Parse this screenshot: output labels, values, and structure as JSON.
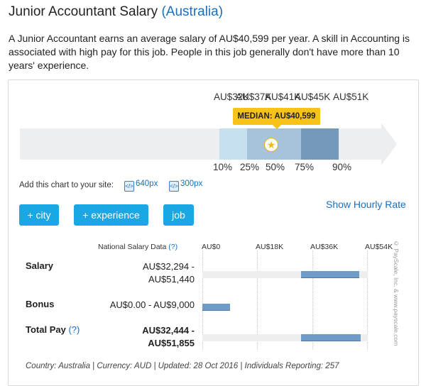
{
  "header": {
    "title": "Junior Accountant Salary",
    "location": "(Australia)"
  },
  "description": "A Junior Accountant earns an average salary of AU$40,599 per year. A skill in Accounting is associated with high pay for this job. People in this job generally don't have more than 10 years' experience.",
  "chart_data": {
    "type": "bar",
    "title": "",
    "percentiles": [
      "10%",
      "25%",
      "50%",
      "75%",
      "90%"
    ],
    "values_label": [
      "AU$32K",
      "AU$37K",
      "AU$41K",
      "AU$45K",
      "AU$51K"
    ],
    "values": [
      32000,
      37000,
      41000,
      45000,
      51000
    ],
    "median_label": "MEDIAN: AU$40,599",
    "median": 40599
  },
  "embed": {
    "label": "Add this chart to your site:",
    "opt1": "640px",
    "opt2": "300px"
  },
  "buttons": {
    "city": "+ city",
    "experience": "+ experience",
    "job": "job"
  },
  "hourly_link": "Show Hourly Rate",
  "table": {
    "header": "National Salary Data",
    "help": "(?)",
    "axis": [
      "AU$0",
      "AU$18K",
      "AU$36K",
      "AU$54K"
    ],
    "axis_max": 54000,
    "rows": [
      {
        "label": "Salary",
        "help": "",
        "value_line1": "AU$32,294 -",
        "value_line2": "AU$51,440",
        "bold": false,
        "min": 32294,
        "max": 51440
      },
      {
        "label": "Bonus",
        "help": "",
        "value_line1": "AU$0.00 - AU$9,000",
        "value_line2": "",
        "bold": false,
        "min": 0,
        "max": 9000
      },
      {
        "label": "Total Pay",
        "help": "(?)",
        "value_line1": "AU$32,444 -",
        "value_line2": "AU$51,855",
        "bold": true,
        "min": 32444,
        "max": 51855
      }
    ]
  },
  "footer": "Country: Australia | Currency: AUD | Updated: 28 Oct 2016 | Individuals Reporting: 257",
  "copyright": "© PayScale, Inc. & www.payscale.com",
  "colors": {
    "link": "#1a6fc0",
    "button": "#1ba6e4",
    "median": "#f8c319",
    "bar": "#6f9bc8"
  }
}
